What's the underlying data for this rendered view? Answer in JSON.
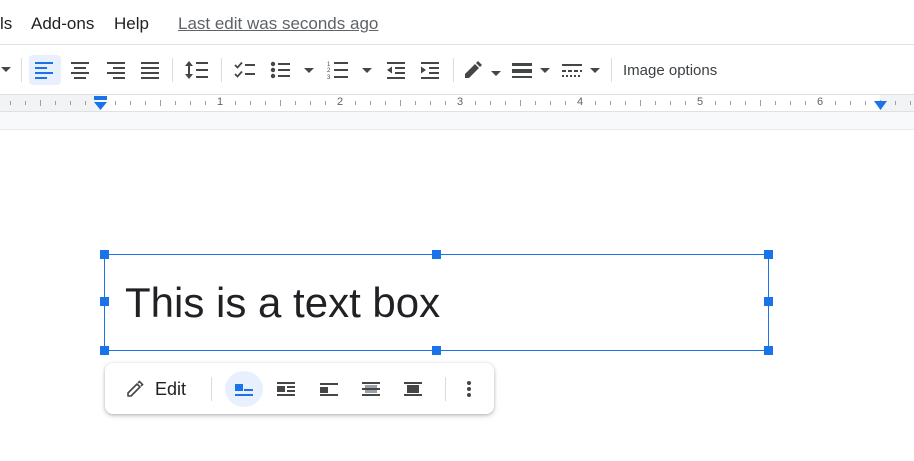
{
  "menu": {
    "items": [
      "ls",
      "Add-ons",
      "Help"
    ],
    "last_edit": "Last edit was seconds ago"
  },
  "toolbar": {
    "image_options": "Image options"
  },
  "ruler": {
    "numbers": [
      "1",
      "2",
      "3",
      "4",
      "5",
      "6"
    ]
  },
  "textbox": {
    "text": "This is a text box"
  },
  "floating_toolbar": {
    "edit_label": "Edit"
  },
  "colors": {
    "accent": "#1a73e8",
    "active_bg": "#e8f0fe",
    "icon": "#444746"
  }
}
